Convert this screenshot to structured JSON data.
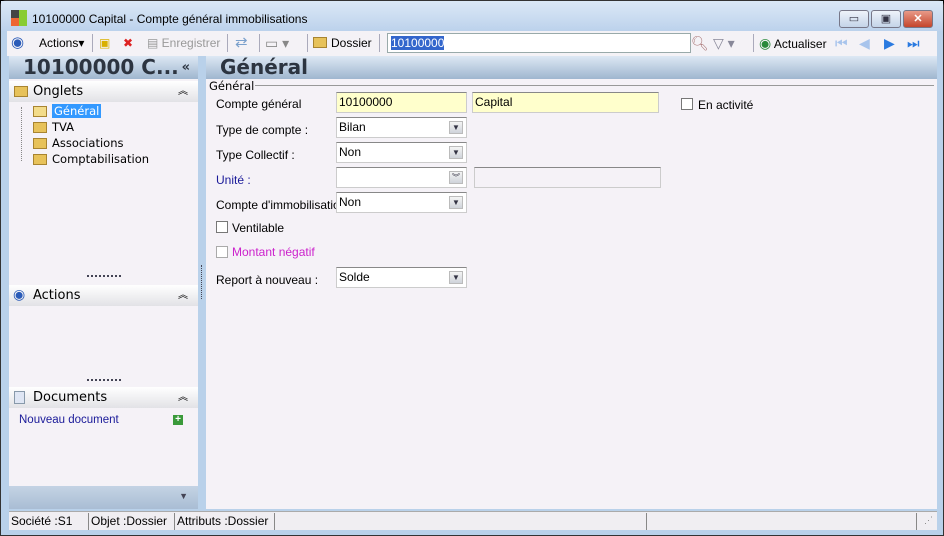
{
  "window": {
    "title": "10100000 Capital -  Compte général immobilisations",
    "minimize": "▭",
    "maximize": "▣",
    "close": "✕"
  },
  "toolbar": {
    "actions_label": "Actions",
    "save_label": "Enregistrer",
    "folder_label": "Dossier",
    "search_value": "10100000",
    "refresh_label": "Actualiser"
  },
  "left": {
    "title": "10100000 C...",
    "collapse": "«",
    "onglets": {
      "title": "Onglets",
      "items": [
        "Général",
        "TVA",
        "Associations",
        "Comptabilisation"
      ]
    },
    "actions": {
      "title": "Actions"
    },
    "documents": {
      "title": "Documents",
      "new_doc": "Nouveau document"
    }
  },
  "main": {
    "title": "Général",
    "group": "Général",
    "fields": {
      "compte_label": "Compte général",
      "compte_value": "10100000",
      "compte_name": "Capital",
      "type_compte_label": "Type de compte :",
      "type_compte_value": "Bilan",
      "type_collectif_label": "Type Collectif :",
      "type_collectif_value": "Non",
      "unite_label": "Unité :",
      "unite_value": "",
      "unite_desc": "",
      "immo_label": "Compte d'immobilisation :",
      "immo_value": "Non",
      "ventilable_label": "Ventilable",
      "ventilable_checked": false,
      "montant_label": "Montant négatif",
      "montant_checked": false,
      "report_label": "Report à nouveau :",
      "report_value": "Solde",
      "actif_label": "En activité",
      "actif_checked": false
    }
  },
  "status": {
    "societe": "Société :S1",
    "objet": "Objet :Dossier",
    "attributs": "Attributs :Dossier"
  },
  "colors": {
    "unite_label": "#1a1a99",
    "montant_label": "#cc22cc",
    "link": "#1a1a99",
    "selection": "#3366cc",
    "required_bg": "#ffffcc"
  }
}
